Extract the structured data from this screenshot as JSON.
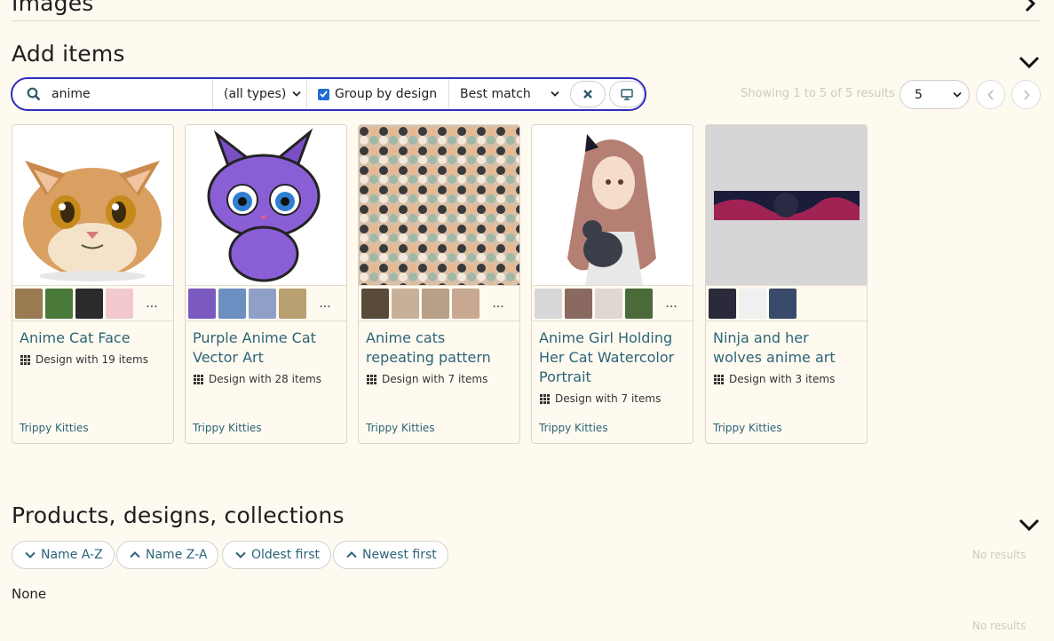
{
  "sections": {
    "images_title": "Images",
    "add_title": "Add items",
    "products_title": "Products, designs, collections"
  },
  "search": {
    "query": "anime",
    "type_value": "(all types)",
    "group_label": "Group by design",
    "group_checked": true,
    "sort_value": "Best match"
  },
  "results": {
    "showing": "Showing 1 to 5 of 5 results",
    "per_page": "5"
  },
  "cards": [
    {
      "title": "Anime Cat Face",
      "sub": "Design with 19 items",
      "shop": "Trippy Kitties",
      "more": "..."
    },
    {
      "title": "Purple Anime Cat Vector Art",
      "sub": "Design with 28 items",
      "shop": "Trippy Kitties",
      "more": "..."
    },
    {
      "title": "Anime cats repeating pattern",
      "sub": "Design with 7 items",
      "shop": "Trippy Kitties",
      "more": "..."
    },
    {
      "title": "Anime Girl Holding Her Cat Watercolor Portrait",
      "sub": "Design with 7 items",
      "shop": "Trippy Kitties",
      "more": "..."
    },
    {
      "title": "Ninja and her wolves anime art",
      "sub": "Design with 3 items",
      "shop": "Trippy Kitties"
    }
  ],
  "products": {
    "sort_buttons": [
      "Name A-Z",
      "Name Z-A",
      "Oldest first",
      "Newest first"
    ],
    "no_results_1": "No results",
    "none_text": "None",
    "no_results_2": "No results"
  },
  "colors": {
    "background": "#fefaf0",
    "accent_border": "#2d2dbf",
    "link": "#2c6478",
    "checkbox": "#1f6fd6"
  }
}
